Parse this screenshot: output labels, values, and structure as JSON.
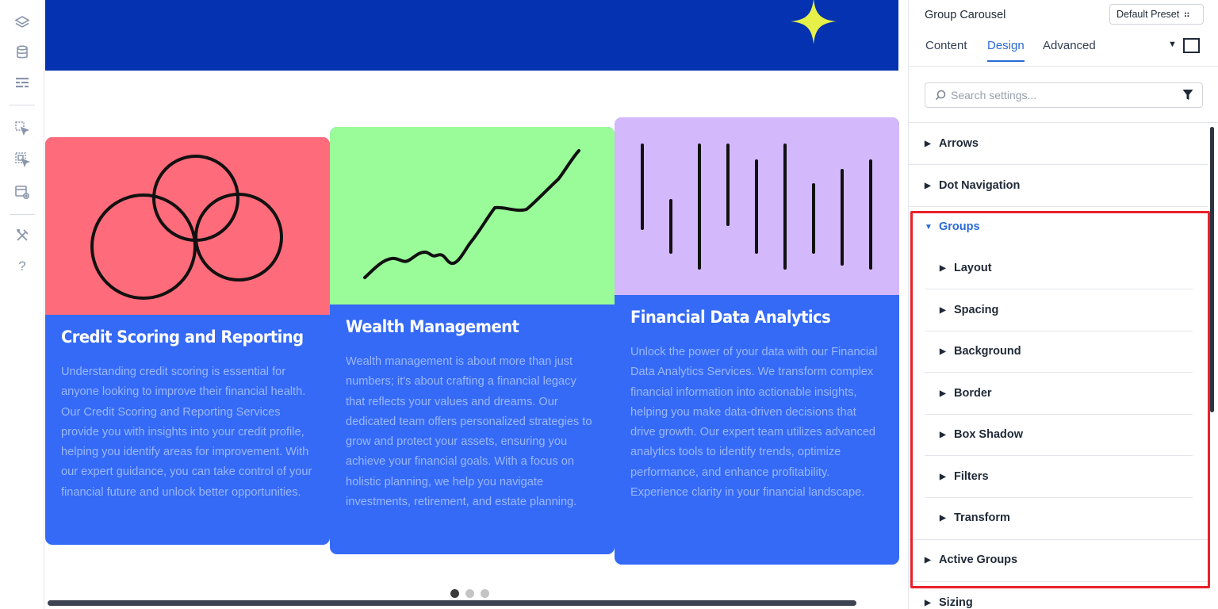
{
  "rail": {
    "icons": [
      "layers-icon",
      "database-icon",
      "layout-icon",
      "pointer-select-icon",
      "multi-select-icon",
      "preview-icon",
      "tools-icon",
      "help-icon"
    ],
    "help_glyph": "?"
  },
  "canvas": {
    "hero_color": "#0432b0",
    "sparkle_color": "#e6f048",
    "cards": [
      {
        "title": "Credit Scoring and Reporting",
        "text": "Understanding credit scoring is essential for anyone looking to improve their financial health. Our Credit Scoring and Reporting Services provide you with insights into your credit profile, helping you identify areas for improvement. With our expert guidance, you can take control of your financial future and unlock better opportunities.",
        "image_color": "#fe6b7a",
        "icon": "venn-circles-icon"
      },
      {
        "title": "Wealth Management",
        "text": "Wealth management is about more than just numbers; it's about crafting a financial legacy that reflects your values and dreams. Our dedicated team offers personalized strategies to grow and protect your assets, ensuring you achieve your financial goals. With a focus on holistic planning, we help you navigate investments, retirement, and estate planning.",
        "image_color": "#9afb99",
        "icon": "growth-line-icon"
      },
      {
        "title": "Financial Data Analytics",
        "text": "Unlock the power of your data with our Financial Data Analytics Services. We transform complex financial information into actionable insights, helping you make data-driven decisions that drive growth. Our expert team utilizes advanced analytics tools to identify trends, optimize performance, and enhance profitability. Experience clarity in your financial landscape.",
        "image_color": "#d3b8fb",
        "icon": "vertical-bars-icon"
      }
    ],
    "dots": {
      "count": 3,
      "active": 0
    },
    "card_color": "#356af7"
  },
  "panel": {
    "title": "Group Carousel",
    "preset": "Default Preset",
    "tabs": [
      {
        "label": "Content",
        "active": false
      },
      {
        "label": "Design",
        "active": true
      },
      {
        "label": "Advanced",
        "active": false
      }
    ],
    "search_placeholder": "Search settings...",
    "sections": {
      "arrows": "Arrows",
      "dot_navigation": "Dot Navigation",
      "groups": "Groups",
      "active_groups": "Active Groups",
      "sizing": "Sizing"
    },
    "group_subsections": [
      "Layout",
      "Spacing",
      "Background",
      "Border",
      "Box Shadow",
      "Filters",
      "Transform"
    ],
    "accent_color": "#2a6ad8",
    "highlight_color": "#e8212b",
    "glyphs": {
      "collapsed": "▶",
      "expanded": "▼",
      "search": "⚲",
      "preset": "⠶",
      "dropdown": "▼"
    }
  }
}
